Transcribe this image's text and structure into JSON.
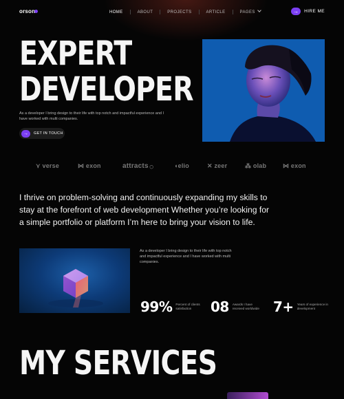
{
  "nav": {
    "logo": "orson",
    "items": [
      {
        "label": "HOME"
      },
      {
        "label": "ABOUT"
      },
      {
        "label": "PROJECTS"
      },
      {
        "label": "ARTICLE"
      },
      {
        "label": "PAGES"
      }
    ],
    "hire_label": "HIRE ME",
    "hire_icon": "arrow-right-icon"
  },
  "hero": {
    "title_line1": "EXPERT",
    "title_line2": "DEVELOPER",
    "description": "As a developer I bring design to their life with top notch and impactful experience and I have worked with multi companies.",
    "cta_label": "GET IN TOUCH",
    "cta_icon": "arrow-right-icon"
  },
  "brands": [
    "verse",
    "exon",
    "attracts",
    "elio",
    "zeer",
    "olab",
    "exon"
  ],
  "about": {
    "text": "I thrive on problem-solving and continuously expanding my skills to stay at the forefront of web development Whether you’re looking for a simple portfolio or platform I’m here to bring your vision to life.",
    "side_description": "As a developer I bring design to their life with top notch and impactful experience and I have worked with multi companies."
  },
  "stats": [
    {
      "value": "99%",
      "label": "Percent of clients satisfaction"
    },
    {
      "value": "08",
      "label": "Awards I have received worldwide"
    },
    {
      "value": "7+",
      "label": "Years of experience in development"
    }
  ],
  "services": {
    "title": "MY SERVICES"
  },
  "colors": {
    "accent": "#7b3ff2",
    "background": "#050505"
  }
}
